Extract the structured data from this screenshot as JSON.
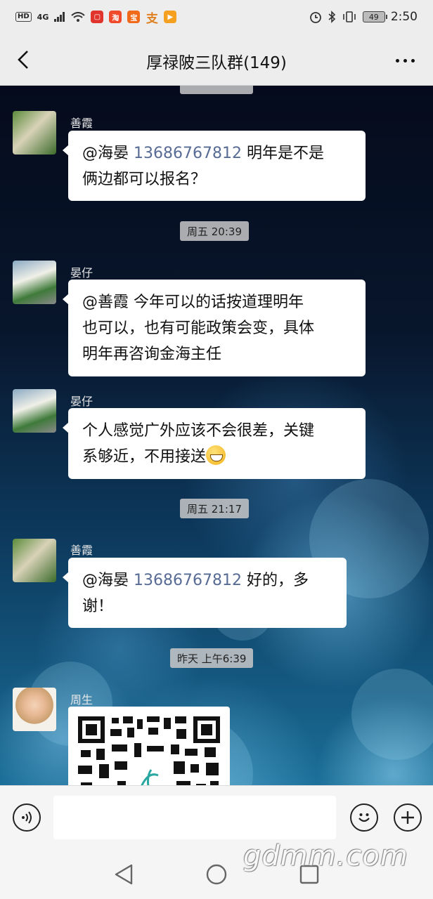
{
  "status_bar": {
    "hd": "HD",
    "network": "4G",
    "battery": "49",
    "time": "2:50"
  },
  "header": {
    "title": "厚禄陂三队群(149)"
  },
  "messages": [
    {
      "sender": "善霞",
      "mention": "@海晏",
      "phone": "13686767812",
      "text_line1_rest": " 明年是不是",
      "text_line2": "俩边都可以报名？"
    },
    {
      "timestamp": "周五 20:39"
    },
    {
      "sender": "晏仔",
      "line1": "@善霞  今年可以的话按道理明年",
      "line2": "也可以，也有可能政策会变，具体",
      "line3": "明年再咨询金海主任"
    },
    {
      "sender": "晏仔",
      "line1": "个人感觉广外应该不会很差，关键",
      "line2": "系够近，不用接送",
      "emoji": "grinning-face-icon"
    },
    {
      "timestamp": "周五 21:17"
    },
    {
      "sender": "善霞",
      "mention": "@海晏",
      "phone": "13686767812",
      "text_line1_rest": " 好的，多",
      "text_line2": "谢！"
    },
    {
      "timestamp": "昨天 上午6:39"
    },
    {
      "sender": "周生",
      "attachment": "qr-code-image"
    }
  ],
  "input": {
    "placeholder": ""
  },
  "watermark": "gdmm.com",
  "colors": {
    "mention_link": "#576b95",
    "bubble": "#ffffff",
    "bar_bg": "#ededed"
  }
}
